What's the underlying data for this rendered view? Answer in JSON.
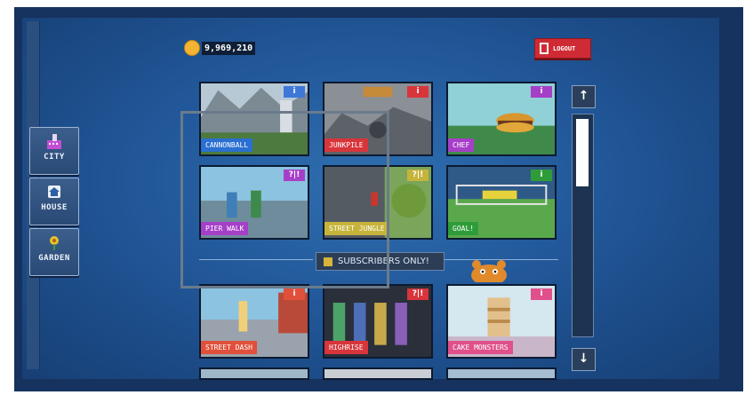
{
  "colors": {
    "accent": "#cf2b34",
    "screen": "#22589a",
    "panel": "#2a4a76"
  },
  "nav": {
    "items": [
      {
        "label": "CITY",
        "icon": "city-icon"
      },
      {
        "label": "HOUSE",
        "icon": "house-icon"
      },
      {
        "label": "GARDEN",
        "icon": "flower-icon"
      }
    ]
  },
  "header": {
    "coins": "9,969,210",
    "logout_label": "LOGOUT"
  },
  "games": [
    {
      "name": "CANNONBALL",
      "tag_color": "#2a6fd1",
      "info_color": "#3d78d8"
    },
    {
      "name": "JUNKPILE",
      "tag_color": "#d8353b",
      "info_color": "#d8353b"
    },
    {
      "name": "CHEF",
      "tag_color": "#a63fc8",
      "info_color": "#a63fc8"
    },
    {
      "name": "PIER WALK",
      "tag_color": "#a63fc8",
      "info_color": "#a63fc8",
      "info_text": "?|!"
    },
    {
      "name": "STREET JUNGLE",
      "tag_color": "#c6b33a",
      "info_color": "#c6b33a",
      "info_text": "?|!"
    },
    {
      "name": "GOAL!",
      "tag_color": "#2f9c3a",
      "info_color": "#2f9c3a"
    },
    {
      "name": "STREET DASH",
      "tag_color": "#e0503a",
      "info_color": "#e0503a"
    },
    {
      "name": "HIGHRISE",
      "tag_color": "#d8353b",
      "info_color": "#d8353b",
      "info_text": "?|!"
    },
    {
      "name": "CAKE MONSTERS",
      "tag_color": "#e0508a",
      "info_color": "#e0508a"
    }
  ],
  "info_label": "i",
  "subscribers_label": "SUBSCRIBERS ONLY!",
  "scroll": {
    "up": "↑",
    "down": "↓",
    "position": 0.0
  }
}
